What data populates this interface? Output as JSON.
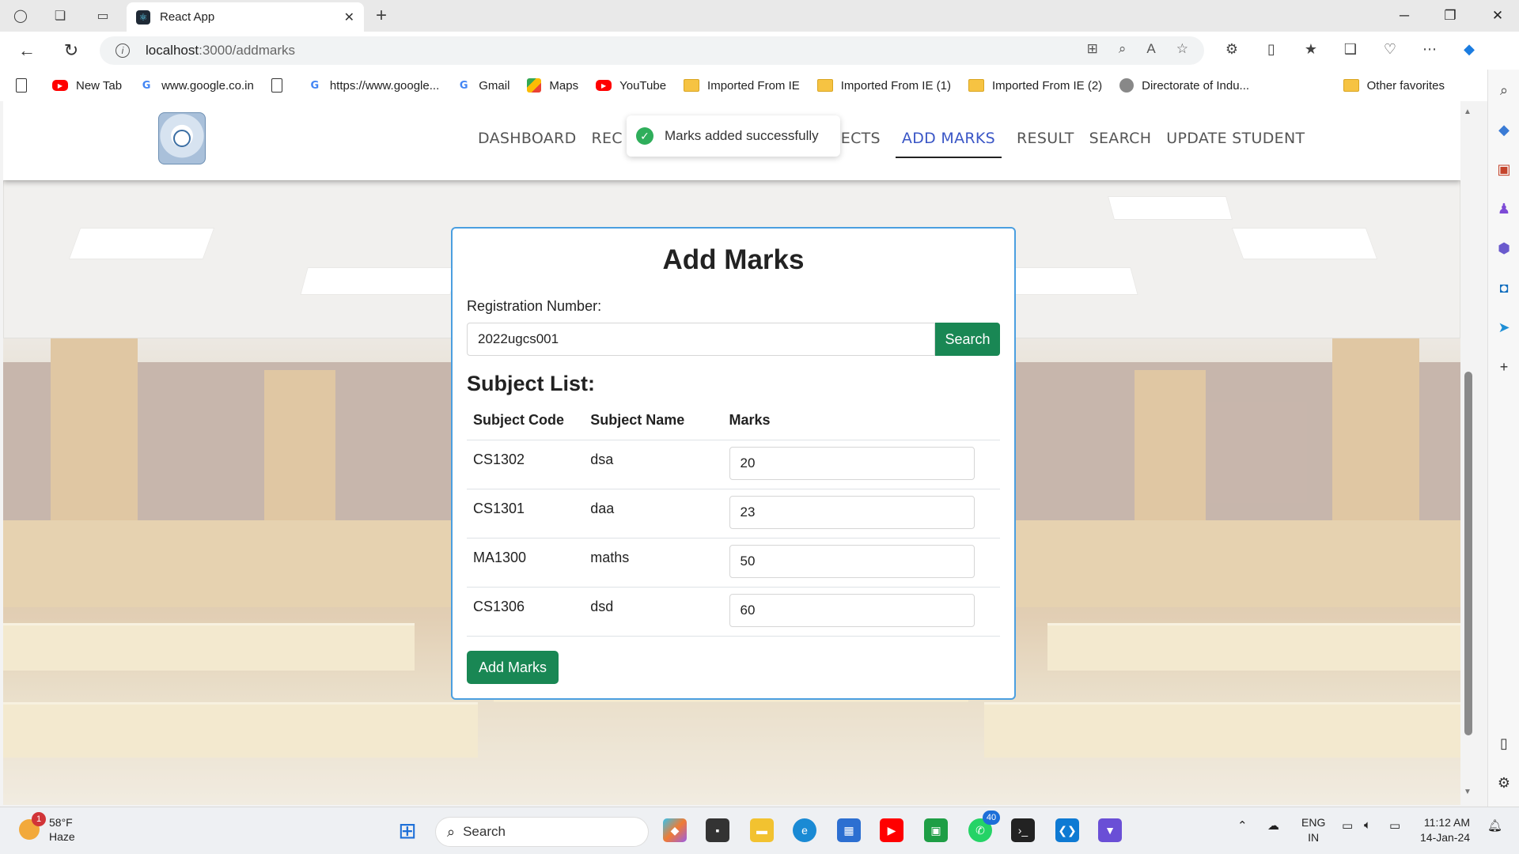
{
  "browser": {
    "tab_title": "React App",
    "url_host": "localhost",
    "url_path": ":3000/addmarks",
    "bookmarks": [
      {
        "label": "New Tab",
        "icon": "youtube-icon"
      },
      {
        "label": "www.google.co.in",
        "icon": "google-icon"
      },
      {
        "label": "",
        "icon": "document-icon"
      },
      {
        "label": "https://www.google...",
        "icon": "google-icon"
      },
      {
        "label": "Gmail",
        "icon": "google-icon"
      },
      {
        "label": "Maps",
        "icon": "maps-icon"
      },
      {
        "label": "YouTube",
        "icon": "youtube-icon"
      },
      {
        "label": "Imported From IE",
        "icon": "folder-icon"
      },
      {
        "label": "Imported From IE (1)",
        "icon": "folder-icon"
      },
      {
        "label": "Imported From IE (2)",
        "icon": "folder-icon"
      },
      {
        "label": "Directorate of Indu...",
        "icon": "emblem-icon"
      }
    ],
    "other_favorites": "Other favorites"
  },
  "nav": {
    "items": [
      "DASHBOARD",
      "REC",
      "JECTS",
      "ADD MARKS",
      "RESULT",
      "SEARCH",
      "UPDATE STUDENT"
    ],
    "active": "ADD MARKS"
  },
  "toast": {
    "message": "Marks added successfully"
  },
  "form": {
    "title": "Add Marks",
    "reg_label": "Registration Number:",
    "reg_value": "2022ugcs001",
    "search_label": "Search",
    "subject_list_title": "Subject List:",
    "columns": [
      "Subject Code",
      "Subject Name",
      "Marks"
    ],
    "rows": [
      {
        "code": "CS1302",
        "name": "dsa",
        "marks": "20"
      },
      {
        "code": "CS1301",
        "name": "daa",
        "marks": "23"
      },
      {
        "code": "MA1300",
        "name": "maths",
        "marks": "50"
      },
      {
        "code": "CS1306",
        "name": "dsd",
        "marks": "60"
      }
    ],
    "submit_label": "Add Marks"
  },
  "taskbar": {
    "weather_temp": "58°F",
    "weather_desc": "Haze",
    "weather_badge": "1",
    "search_placeholder": "Search",
    "whatsapp_badge": "40",
    "lang_1": "ENG",
    "lang_2": "IN",
    "time": "11:12 AM",
    "date": "14-Jan-24"
  },
  "colors": {
    "accent_green": "#198754",
    "nav_active": "#3a56c6",
    "card_border": "#4b9fe0",
    "toast_icon": "#2fae5b"
  }
}
